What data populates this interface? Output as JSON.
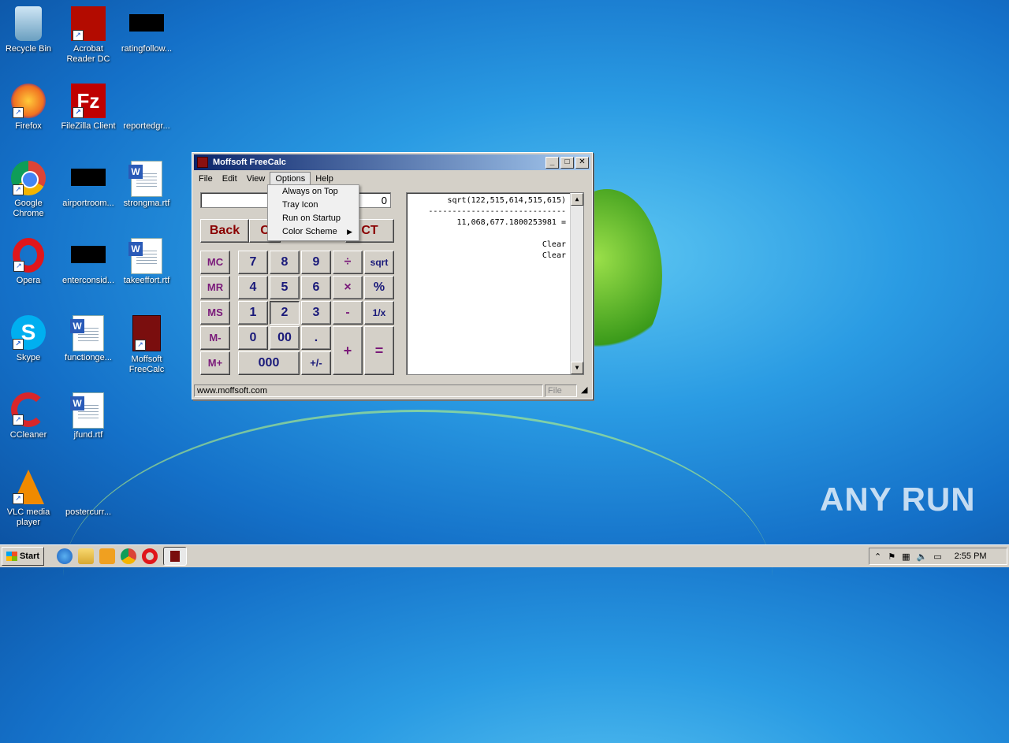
{
  "desktop": {
    "icons": [
      {
        "label": "Recycle Bin"
      },
      {
        "label": "Acrobat Reader DC"
      },
      {
        "label": "ratingfollow..."
      },
      {
        "label": "Firefox"
      },
      {
        "label": "FileZilla Client"
      },
      {
        "label": "reportedgr..."
      },
      {
        "label": "Google Chrome"
      },
      {
        "label": "airportroom..."
      },
      {
        "label": "strongma.rtf"
      },
      {
        "label": "Opera"
      },
      {
        "label": "enterconsid..."
      },
      {
        "label": "takeeffort.rtf"
      },
      {
        "label": "Skype"
      },
      {
        "label": "functionge..."
      },
      {
        "label": "Moffsoft FreeCalc"
      },
      {
        "label": "CCleaner"
      },
      {
        "label": "jfund.rtf"
      },
      {
        "label": "VLC media player"
      },
      {
        "label": "postercurr..."
      }
    ]
  },
  "window": {
    "title": "Moffsoft FreeCalc",
    "menu": [
      "File",
      "Edit",
      "View",
      "Options",
      "Help"
    ],
    "display_value": "0",
    "buttons": {
      "back": "Back",
      "ct": "CT",
      "c_hidden": "C",
      "mc": "MC",
      "mr": "MR",
      "ms": "MS",
      "mminus": "M-",
      "mplus": "M+",
      "n7": "7",
      "n8": "8",
      "n9": "9",
      "div": "÷",
      "sqrt": "sqrt",
      "n4": "4",
      "n5": "5",
      "n6": "6",
      "mul": "×",
      "pct": "%",
      "n1": "1",
      "n2": "2",
      "n3": "3",
      "sub": "-",
      "inv": "1/x",
      "n0": "0",
      "n00": "00",
      "dot": ".",
      "add": "+",
      "eq": "=",
      "n000": "000",
      "pm": "+/-"
    },
    "tape": [
      "sqrt(122,515,614,515,615)",
      "-----------------------------",
      "11,068,677.1800253981 =",
      "",
      "Clear",
      "Clear"
    ],
    "status_left": "www.moffsoft.com",
    "status_right": "File"
  },
  "options_menu": {
    "items": [
      {
        "label": "Always on Top",
        "submenu": false
      },
      {
        "label": "Tray Icon",
        "submenu": false
      },
      {
        "label": "Run on Startup",
        "submenu": false
      },
      {
        "label": "Color Scheme",
        "submenu": true
      }
    ]
  },
  "taskbar": {
    "start_label": "Start",
    "clock": "2:55 PM"
  },
  "watermark": "ANY RUN"
}
